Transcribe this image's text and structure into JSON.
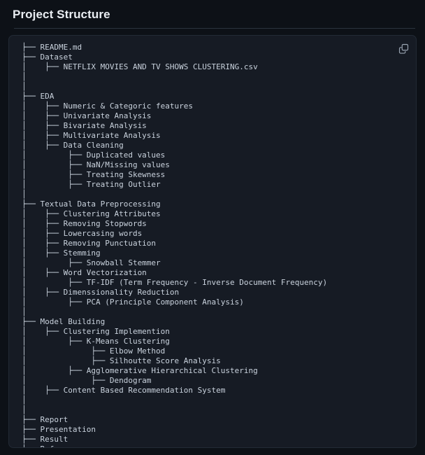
{
  "header": {
    "title": "Project Structure"
  },
  "panel": {
    "copy_button_label": "Copy",
    "copy_icon": "copy-icon",
    "background_color": "#161b24",
    "text_color": "#c9d2dd"
  },
  "tree": {
    "lines": [
      "├── README.md",
      "├── Dataset",
      "│    ├── NETFLIX MOVIES AND TV SHOWS CLUSTERING.csv",
      "│",
      "│",
      "├── EDA",
      "│    ├── Numeric & Categoric features",
      "│    ├── Univariate Analysis",
      "│    ├── Bivariate Analysis",
      "│    ├── Multivariate Analysis",
      "│    ├── Data Cleaning",
      "│         ├── Duplicated values",
      "│         ├── NaN/Missing values",
      "│         ├── Treating Skewness",
      "│         ├── Treating Outlier",
      "│",
      "├── Textual Data Preprocessing",
      "│    ├── Clustering Attributes",
      "│    ├── Removing Stopwords",
      "│    ├── Lowercasing words",
      "│    ├── Removing Punctuation",
      "│    ├── Stemming",
      "│         ├── Snowball Stemmer",
      "│    ├── Word Vectorization",
      "│         ├── TF-IDF (Term Frequency - Inverse Document Frequency)",
      "│    ├── Dimenssionality Reduction",
      "│         ├── PCA (Principle Component Analysis)",
      "│",
      "├── Model Building",
      "│    ├── Clustering Implemention",
      "│         ├── K-Means Clustering",
      "│              ├── Elbow Method",
      "│              ├── Silhoutte Score Analysis",
      "│         ├── Agglomerative Hierarchical Clustering",
      "│              ├── Dendogram",
      "│    ├── Content Based Recommendation System",
      "│",
      "│",
      "├── Report",
      "├── Presentation",
      "├── Result",
      "└── Reference"
    ]
  }
}
